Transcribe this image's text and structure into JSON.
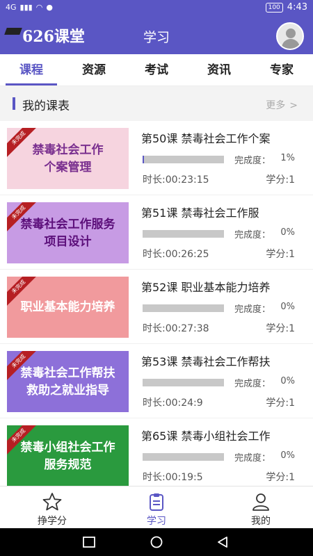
{
  "statusbar": {
    "signal": "4G",
    "battery": "100",
    "time": "4:43"
  },
  "header": {
    "logo_text": "626课堂",
    "title": "学习"
  },
  "tabs": [
    {
      "label": "课程",
      "active": true
    },
    {
      "label": "资源",
      "active": false
    },
    {
      "label": "考试",
      "active": false
    },
    {
      "label": "资讯",
      "active": false
    },
    {
      "label": "专家",
      "active": false
    }
  ],
  "section": {
    "title": "我的课表",
    "more": "更多"
  },
  "labels": {
    "progress": "完成度："
  },
  "courses": [
    {
      "thumb_text": "禁毒社会工作\n个案管理",
      "badge": "未完成",
      "title": "第50课 禁毒社会工作个案",
      "progress": "1%",
      "progress_value": 1,
      "duration": "时长:00:23:15",
      "credit": "学分:1",
      "bg": "#f6d4df"
    },
    {
      "thumb_text": "禁毒社会工作服务\n项目设计",
      "badge": "未完成",
      "title": "第51课  禁毒社会工作服",
      "progress": "0%",
      "progress_value": 0,
      "duration": "时长:00:26:25",
      "credit": "学分:1",
      "bg": "#c79be4"
    },
    {
      "thumb_text": "职业基本能力培养",
      "badge": "未完成",
      "title": "第52课 职业基本能力培养",
      "progress": "0%",
      "progress_value": 0,
      "duration": "时长:00:27:38",
      "credit": "学分:1",
      "bg": "#f19a9d"
    },
    {
      "thumb_text": "禁毒社会工作帮扶\n救助之就业指导",
      "badge": "未完成",
      "title": "第53课 禁毒社会工作帮扶",
      "progress": "0%",
      "progress_value": 0,
      "duration": "时长:00:24:9",
      "credit": "学分:1",
      "bg": "#8d70d9"
    },
    {
      "thumb_text": "禁毒小组社会工作\n服务规范",
      "badge": "未完成",
      "title": "第65课 禁毒小组社会工作",
      "progress": "0%",
      "progress_value": 0,
      "duration": "时长:00:19:5",
      "credit": "学分:1",
      "bg": "#2a9a3e"
    }
  ],
  "bottomnav": [
    {
      "label": "挣学分",
      "icon": "star-icon",
      "active": false
    },
    {
      "label": "学习",
      "icon": "clipboard-icon",
      "active": true
    },
    {
      "label": "我的",
      "icon": "person-icon",
      "active": false
    }
  ],
  "colors": {
    "accent": "#5a56c4"
  }
}
